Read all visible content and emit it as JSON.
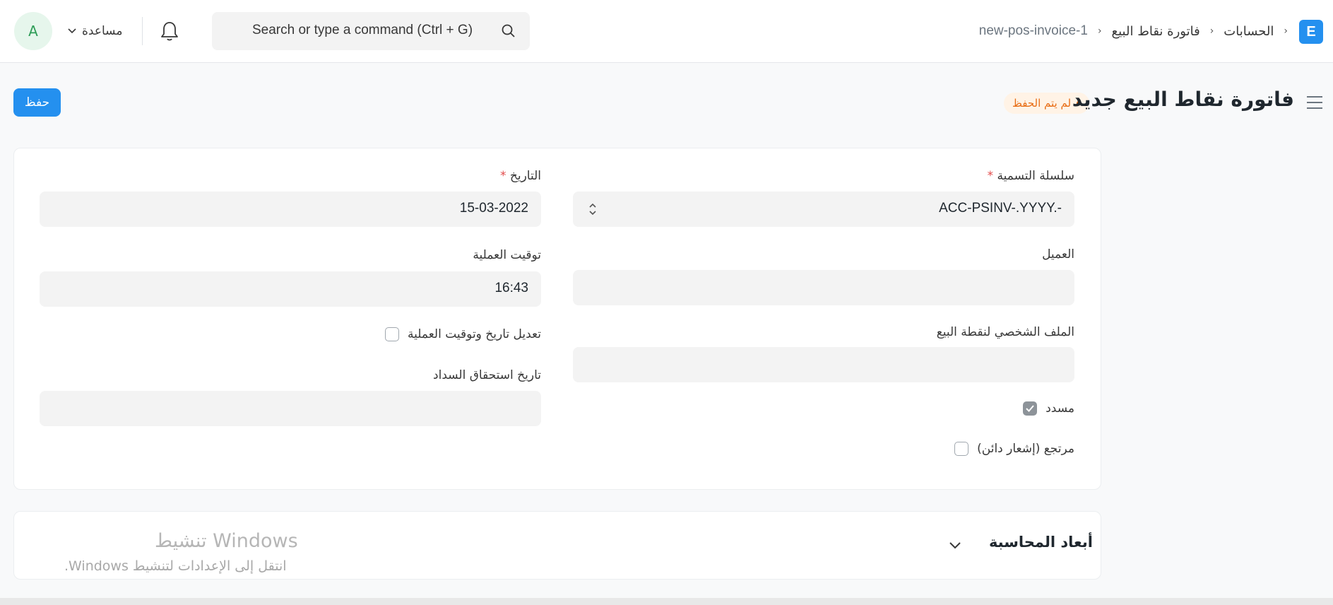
{
  "navbar": {
    "avatar_initial": "A",
    "help_label": "مساعدة",
    "search_placeholder": "Search or type a command (Ctrl + G)",
    "app_logo": "E",
    "breadcrumbs": [
      "الحسابات",
      "فاتورة نقاط البيع",
      "new-pos-invoice-1"
    ]
  },
  "page": {
    "title": "فاتورة نقاط البيع جديد",
    "status": "لم يتم الحفظ",
    "save_label": "حفظ"
  },
  "form": {
    "naming_series": {
      "label": "سلسلة التسمية",
      "value": "ACC-PSINV-.YYYY.-"
    },
    "customer": {
      "label": "العميل",
      "value": ""
    },
    "pos_profile": {
      "label": "الملف الشخصي لنقطة البيع",
      "value": ""
    },
    "is_paid": {
      "label": "مسدد",
      "checked": true
    },
    "is_return": {
      "label": "مرتجع (إشعار دائن)",
      "checked": false
    },
    "posting_date": {
      "label": "التاريخ",
      "value": "15-03-2022"
    },
    "posting_time": {
      "label": "توقيت العملية",
      "value": "16:43"
    },
    "edit_posting": {
      "label": "تعديل تاريخ وتوقيت العملية",
      "checked": false
    },
    "due_date": {
      "label": "تاريخ استحقاق السداد",
      "value": ""
    }
  },
  "section": {
    "title": "أبعاد المحاسبة"
  },
  "watermark": {
    "title": "تنشيط Windows",
    "subtitle": "انتقل إلى الإعدادات لتنشيط Windows."
  },
  "colors": {
    "primary": "#2490ef",
    "warning": "#e86c13",
    "required": "#e24c4c"
  }
}
